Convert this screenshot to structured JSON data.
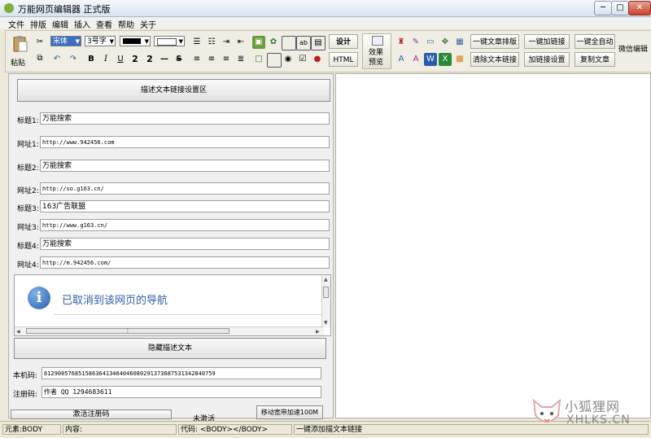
{
  "window": {
    "title": "万能网页编辑器 正式版",
    "minimize": "─",
    "maximize": "□",
    "close": "✕"
  },
  "menu": [
    "文件",
    "排版",
    "编辑",
    "插入",
    "查看",
    "帮助",
    "关于"
  ],
  "toolbar": {
    "paste_label": "粘贴",
    "font_family": "宋体",
    "font_size": "3号字",
    "bold": "B",
    "italic": "I",
    "underline": "U",
    "superscript": "2",
    "subscript": "2",
    "hr": "—",
    "strike": "S",
    "design_label": "设计",
    "html_label": "HTML",
    "preview_label_1": "效果",
    "preview_label_2": "预览",
    "buttons": [
      "一键文章排版",
      "一键加链接",
      "一键全自动",
      "清除文本链接",
      "加链接设置",
      "复制文章"
    ],
    "wechat_label": "微信编辑"
  },
  "left": {
    "settings_header": "描述文本链接设置区",
    "rows": [
      {
        "label": "标题1:",
        "value": "万能搜索",
        "mono": false
      },
      {
        "label": "网址1:",
        "value": "http://www.942456.com",
        "mono": true
      },
      {
        "label": "标题2:",
        "value": "万能搜索",
        "mono": false
      },
      {
        "label": "网址2:",
        "value": "http://so.g163.cn/",
        "mono": true
      },
      {
        "label": "标题3:",
        "value": "163广告联盟",
        "mono": false
      },
      {
        "label": "网址3:",
        "value": "http://www.g163.cn/",
        "mono": true
      },
      {
        "label": "标题4:",
        "value": "万能搜索",
        "mono": false
      },
      {
        "label": "网址4:",
        "value": "http://m.942456.com/",
        "mono": true
      }
    ],
    "nav_message": "已取消到该网页的导航",
    "info_icon": "i",
    "hide_button": "隐藏描述文本",
    "machine_code_label": "本机码:",
    "machine_code": "61290057685158636413464046080291373687531342840759",
    "reg_code_label": "注册码:",
    "reg_code": "作者 QQ 1294683611",
    "activate_button": "激活注册码",
    "not_activated": "未激活",
    "speed_button": "移动宽带加速100M"
  },
  "status": {
    "element": "元素:BODY",
    "content": "内容:",
    "code": "代码: <BODY></BODY>",
    "hint": "一键添加描文本链接"
  },
  "watermark": {
    "cn": "小狐狸网",
    "en": "XHLKS.CN"
  },
  "colors": {
    "fore_swatch": "#000000",
    "back_swatch": "#ffffff",
    "nav_text": "#2f5ea8"
  }
}
